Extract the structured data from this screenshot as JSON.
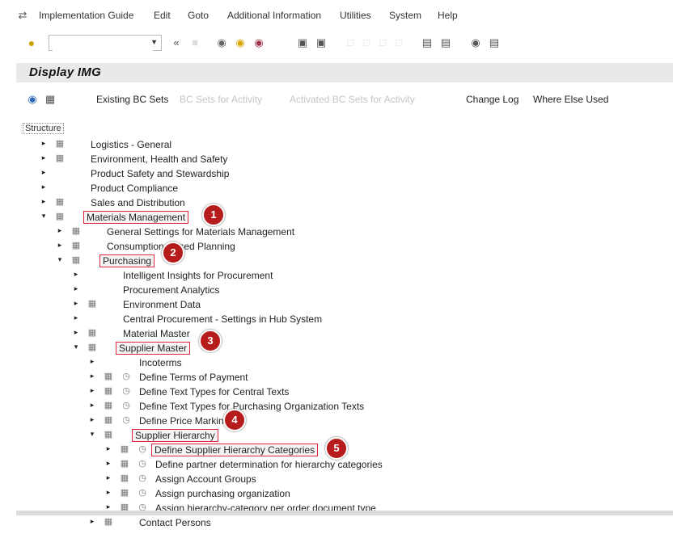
{
  "menubar": {
    "items": [
      "Implementation Guide",
      "Edit",
      "Goto",
      "Additional Information",
      "Utilities",
      "System",
      "Help"
    ]
  },
  "toolbar": {
    "command_field_value": ""
  },
  "title": "Display IMG",
  "appbar": {
    "existing_bc_sets": "Existing BC Sets",
    "faint_1": "BC Sets for Activity",
    "faint_2": "Activated BC Sets for Activity",
    "change_log": "Change Log",
    "where_else_used": "Where Else Used"
  },
  "tree": {
    "structure_label": "Structure",
    "rows": [
      "Logistics - General",
      "Environment, Health and Safety",
      "Product Safety and Stewardship",
      "Product Compliance",
      "Sales and Distribution",
      "Materials Management",
      "General Settings for Materials Management",
      "Consumption-Based Planning",
      "Purchasing",
      "Intelligent Insights for Procurement",
      "Procurement Analytics",
      "Environment Data",
      "Central Procurement - Settings in Hub System",
      "Material Master",
      "Supplier Master",
      "Incoterms",
      "Define Terms of Payment",
      "Define Text Types for Central Texts",
      "Define Text Types for Purchasing Organization Texts",
      "Define Price Marking",
      "Supplier Hierarchy",
      "Define Supplier Hierarchy Categories",
      "Define partner determination for hierarchy categories",
      "Assign Account Groups",
      "Assign purchasing organization",
      "Assign hierarchy-category per order document type",
      "Contact Persons"
    ]
  },
  "badges": [
    "1",
    "2",
    "3",
    "4",
    "5"
  ],
  "colors": {
    "highlight": "#e0253c",
    "badge": "#b71c1c",
    "titlebar": "#e9e9e9"
  }
}
